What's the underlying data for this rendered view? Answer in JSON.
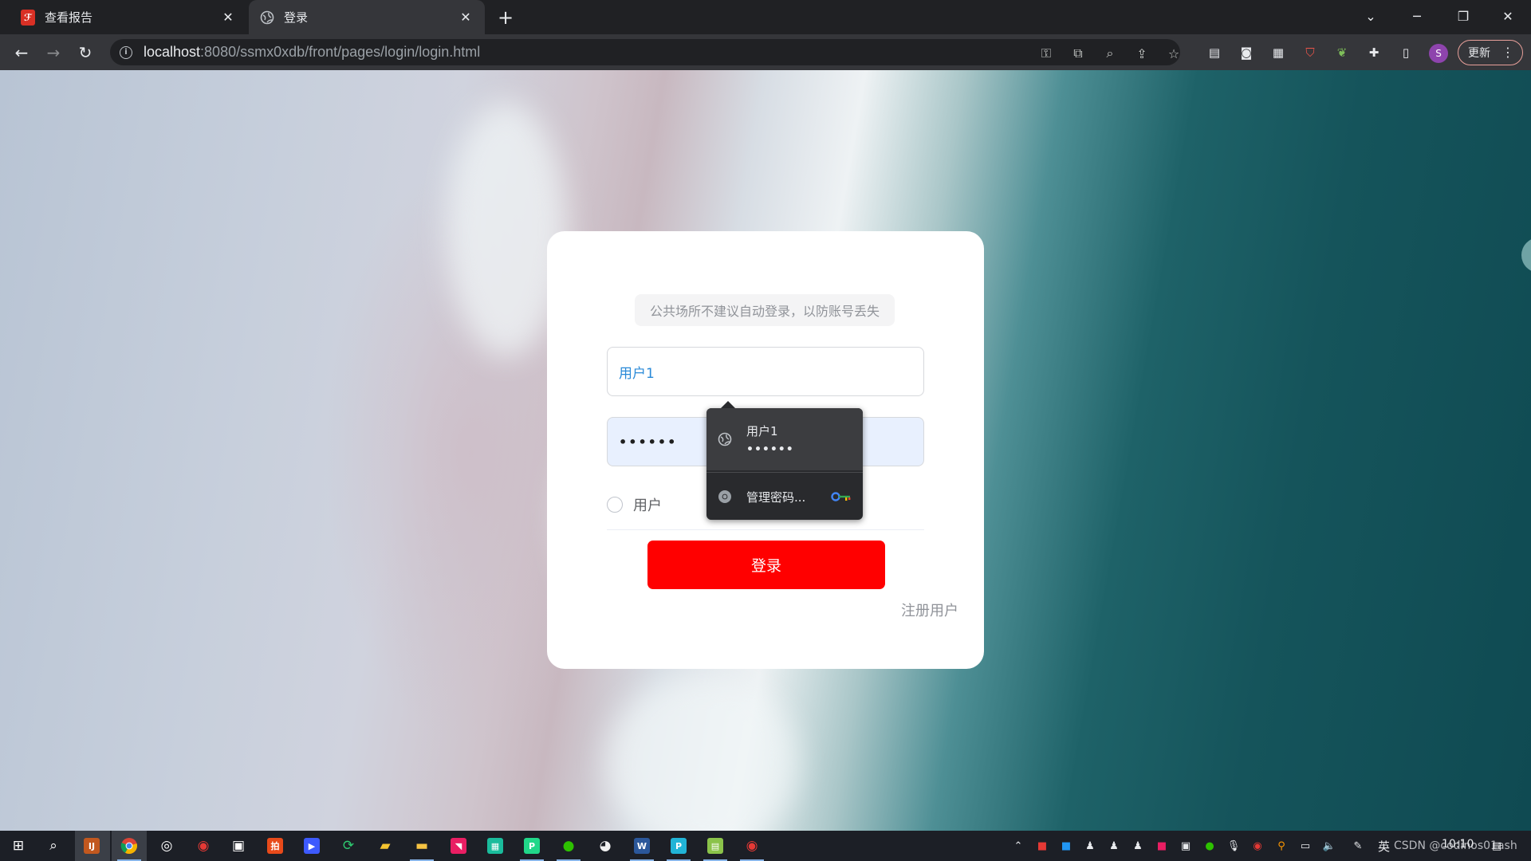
{
  "browser": {
    "tabs": [
      {
        "title": "查看报告",
        "favicon": "pdf-icon",
        "active": false
      },
      {
        "title": "登录",
        "favicon": "globe-icon",
        "active": true
      }
    ],
    "new_tab_glyph": "+",
    "close_glyph": "✕",
    "url": {
      "host": "localhost",
      "rest": ":8080/ssmx0xdb/front/pages/login/login.html"
    },
    "avatar_initial": "S",
    "update_label": "更新"
  },
  "login": {
    "tip": "公共场所不建议自动登录，以防账号丢失",
    "username_value": "用户1",
    "password_mask": "••••••",
    "role_option": "用户",
    "login_button": "登录",
    "register_link": "注册用户",
    "accent_color": "#ff0000"
  },
  "autofill": {
    "username": "用户1",
    "password_mask": "••••••",
    "manage_label": "管理密码..."
  },
  "taskbar": {
    "ime_label": "英",
    "clock": "10:10",
    "watermark": "CSDN @codinos01ash"
  }
}
